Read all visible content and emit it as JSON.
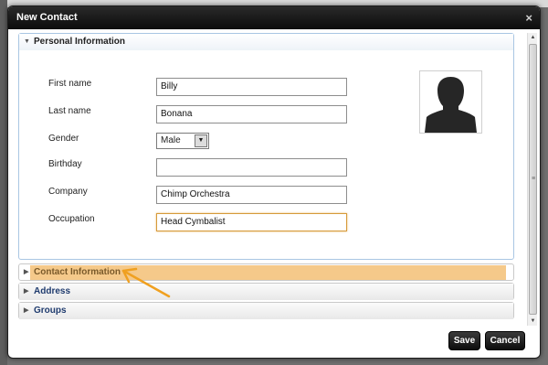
{
  "dialog": {
    "title": "New Contact",
    "close_label": "×"
  },
  "sections": {
    "personal": {
      "label": "Personal Information"
    },
    "contact": {
      "label": "Contact Information"
    },
    "address": {
      "label": "Address"
    },
    "groups": {
      "label": "Groups"
    }
  },
  "form": {
    "first_name": {
      "label": "First name",
      "value": "Billy"
    },
    "last_name": {
      "label": "Last name",
      "value": "Bonana"
    },
    "gender": {
      "label": "Gender",
      "value": "Male"
    },
    "birthday": {
      "label": "Birthday",
      "value": ""
    },
    "company": {
      "label": "Company",
      "value": "Chimp Orchestra"
    },
    "occupation": {
      "label": "Occupation",
      "value": "Head Cymbalist"
    }
  },
  "buttons": {
    "save": "Save",
    "cancel": "Cancel"
  },
  "colors": {
    "highlight": "#f5c98a",
    "arrow": "#f0a020",
    "titlebar": "#111111"
  }
}
